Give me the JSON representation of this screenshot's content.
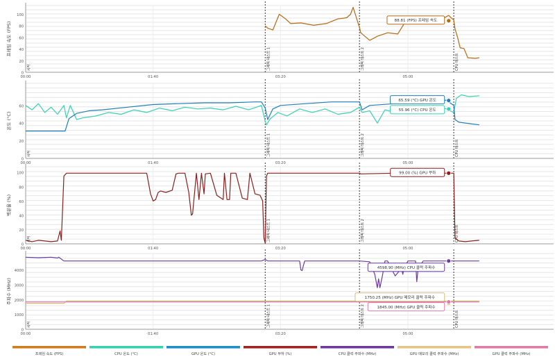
{
  "chart_data": {
    "type": "line",
    "x_ticks": [
      "00:00",
      "01:40",
      "03:20",
      "05:00"
    ],
    "x_range_seconds": [
      0,
      361
    ],
    "markers": [
      {
        "t": 0,
        "label": "시작"
      },
      {
        "t": 188,
        "label": "그래픽 테스트 1"
      },
      {
        "t": 262,
        "label": "그래픽 테스트 2"
      },
      {
        "t": 336,
        "label": "CPU 테스트"
      }
    ],
    "panels": [
      {
        "id": "fps",
        "ylabel": "프레임 속도 (FPS)",
        "ylim": [
          0,
          115
        ],
        "yticks": [
          0,
          20,
          40,
          60,
          80,
          100
        ],
        "series": [
          {
            "name": "프레임 속도 (FPS)",
            "color": "#b8680f",
            "t": [
              188,
              190,
              194,
              199,
              204,
              208,
              216,
              226,
              236,
              245,
              252,
              255,
              257,
              262,
              263,
              270,
              276,
              284,
              292,
              300,
              312,
              322,
              332,
              336,
              337,
              339,
              341,
              344,
              347,
              353,
              356
            ],
            "v": [
              80,
              76,
              73,
              100,
              92,
              84,
              85,
              81,
              84,
              92,
              94,
              100,
              112,
              77,
              68,
              55,
              62,
              68,
              66,
              94,
              88,
              86,
              98,
              90,
              75,
              60,
              42,
              41,
              25,
              24,
              25
            ]
          }
        ],
        "callouts": [
          {
            "text": "88.81 (FPS) 프레임 속도",
            "color": "#b8680f",
            "t": 332,
            "v": 88.81
          }
        ]
      },
      {
        "id": "temp",
        "ylabel": "온도 (°C)",
        "ylim": [
          0,
          85
        ],
        "yticks": [
          0,
          20,
          40,
          60
        ],
        "series": [
          {
            "name": "CPU 온도 (°C)",
            "color": "#35d2b1",
            "t": [
              0,
              5,
              10,
              15,
              20,
              25,
              30,
              32,
              35,
              40,
              45,
              55,
              65,
              75,
              85,
              95,
              105,
              115,
              125,
              135,
              145,
              155,
              165,
              175,
              185,
              188,
              189,
              192,
              198,
              205,
              215,
              225,
              235,
              245,
              255,
              262,
              264,
              270,
              276,
              282,
              290,
              300,
              310,
              320,
              330,
              336,
              338,
              342,
              348,
              356
            ],
            "v": [
              60,
              55,
              62,
              52,
              58,
              50,
              60,
              46,
              60,
              44,
              46,
              48,
              52,
              50,
              55,
              52,
              57,
              54,
              58,
              56,
              57,
              55,
              59,
              55,
              60,
              42,
              38,
              45,
              52,
              48,
              56,
              52,
              56,
              50,
              52,
              58,
              52,
              54,
              40,
              55,
              52,
              58,
              55,
              60,
              56,
              52,
              68,
              72,
              70,
              71
            ]
          },
          {
            "name": "GPU 온도 (°C)",
            "color": "#1f7eb8",
            "t": [
              0,
              10,
              20,
              30,
              31,
              34,
              40,
              50,
              60,
              80,
              100,
              120,
              140,
              160,
              180,
              185,
              188,
              190,
              194,
              200,
              220,
              240,
              262,
              264,
              270,
              290,
              310,
              320,
              330,
              336,
              337,
              340,
              350,
              356
            ],
            "v": [
              31,
              31,
              31,
              31,
              31,
              45,
              51,
              54,
              55,
              58,
              61,
              62,
              63,
              63,
              64,
              64,
              57,
              44,
              56,
              60,
              62,
              64,
              64,
              55,
              60,
              62,
              63,
              64,
              66,
              60,
              44,
              41,
              39,
              38
            ]
          }
        ],
        "callouts": [
          {
            "text": "65.59 (°C) GPU 온도",
            "color": "#1f7eb8",
            "t": 332,
            "v": 65.59
          },
          {
            "text": "55.96 (°C) CPU 온도",
            "color": "#35d2b1",
            "t": 332,
            "v": 55.96
          }
        ]
      },
      {
        "id": "load",
        "ylabel": "백분율 (%)",
        "ylim": [
          0,
          108
        ],
        "yticks": [
          0,
          20,
          40,
          60,
          80,
          100
        ],
        "series": [
          {
            "name": "GPU 부하 (%)",
            "color": "#8c1c1c",
            "t": [
              0,
              5,
              10,
              20,
              25,
              27,
              28,
              30,
              32,
              95,
              98,
              100,
              102,
              104,
              106,
              110,
              115,
              118,
              120,
              125,
              128,
              130,
              131,
              134,
              136,
              138,
              140,
              141,
              145,
              150,
              155,
              156,
              158,
              160,
              161,
              165,
              170,
              174,
              176,
              180,
              184,
              186,
              187,
              188,
              189,
              190,
              262,
              263,
              290,
              300,
              320,
              335,
              336,
              337,
              340,
              345,
              350,
              356
            ],
            "v": [
              5,
              3,
              5,
              3,
              4,
              18,
              5,
              95,
              99,
              99,
              70,
              60,
              62,
              72,
              74,
              72,
              75,
              98,
              99,
              99,
              72,
              40,
              42,
              99,
              62,
              99,
              70,
              98,
              99,
              68,
              62,
              99,
              62,
              62,
              99,
              99,
              64,
              62,
              99,
              70,
              68,
              60,
              8,
              1,
              95,
              99,
              99,
              98,
              99,
              99,
              99,
              99,
              99,
              8,
              4,
              3,
              4,
              5
            ]
          }
        ],
        "callouts": [
          {
            "text": "99.00 (%) GPU 부하",
            "color": "#8c1c1c",
            "t": 332,
            "v": 99.0
          }
        ]
      },
      {
        "id": "clock",
        "ylabel": "주파수 (MHz)",
        "ylim": [
          0,
          5100
        ],
        "yticks": [
          0,
          1000,
          2000,
          3000,
          4000
        ],
        "series": [
          {
            "name": "CPU 클럭 주파수 (MHz)",
            "color": "#6a3aa0",
            "t": [
              0,
              10,
              20,
              25,
              26,
              30,
              40,
              100,
              150,
              185,
              188,
              190,
              215,
              216,
              217,
              218,
              219,
              220,
              262,
              270,
              274,
              276,
              277,
              278,
              280,
              281,
              282,
              284,
              290,
              295,
              296,
              297,
              300,
              306,
              307,
              308,
              312,
              330,
              356
            ],
            "v": [
              4850,
              4820,
              4850,
              4800,
              4850,
              4600,
              4599,
              4599,
              4599,
              4599,
              4700,
              4599,
              4599,
              4000,
              3950,
              4300,
              4599,
              4599,
              4599,
              4550,
              3700,
              2800,
              3400,
              2800,
              3600,
              4100,
              4599,
              4599,
              3600,
              4100,
              3700,
              4100,
              4599,
              4599,
              3200,
              4100,
              4599,
              4599,
              4599
            ]
          },
          {
            "name": "GPU 메모리 클럭 주파수 (MHz)",
            "color": "#d8bc7a",
            "t": [
              0,
              30,
              32,
              356
            ],
            "v": [
              1750,
              1750,
              1900,
              1900
            ]
          },
          {
            "name": "GPU 클럭 주파수 (MHz)",
            "color": "#e07aa8",
            "t": [
              0,
              30,
              32,
              356
            ],
            "v": [
              1845,
              1845,
              1845,
              1845
            ]
          }
        ],
        "callouts": [
          {
            "text": "4598.90 (MHz) CPU 클럭 주파수",
            "color": "#6a3aa0",
            "t": 332,
            "v": 4598.9
          },
          {
            "text": "1750.25 (MHz) GPU 메모리 클럭 주파수",
            "color": "#d8bc7a",
            "t": 332,
            "v": 1750.25
          },
          {
            "text": "1845.00 (MHz) GPU 클럭 주파수",
            "color": "#e07aa8",
            "t": 332,
            "v": 1845.0
          }
        ]
      }
    ],
    "legend": [
      {
        "label": "프레임 속도 (FPS)",
        "color": "#d27a1e"
      },
      {
        "label": "CPU 온도 (°C)",
        "color": "#35d2b1"
      },
      {
        "label": "GPU 온도 (°C)",
        "color": "#1f8ec8"
      },
      {
        "label": "GPU 부하 (%)",
        "color": "#a22020"
      },
      {
        "label": "CPU 클럭 주파수 (MHz)",
        "color": "#6a3aa0"
      },
      {
        "label": "GPU 메모리 클럭 주파수 (MHz)",
        "color": "#e6c487"
      },
      {
        "label": "GPU 클럭 주파수 (MHz)",
        "color": "#e07aa8"
      }
    ],
    "legend_position": "bottom",
    "grid": true
  }
}
